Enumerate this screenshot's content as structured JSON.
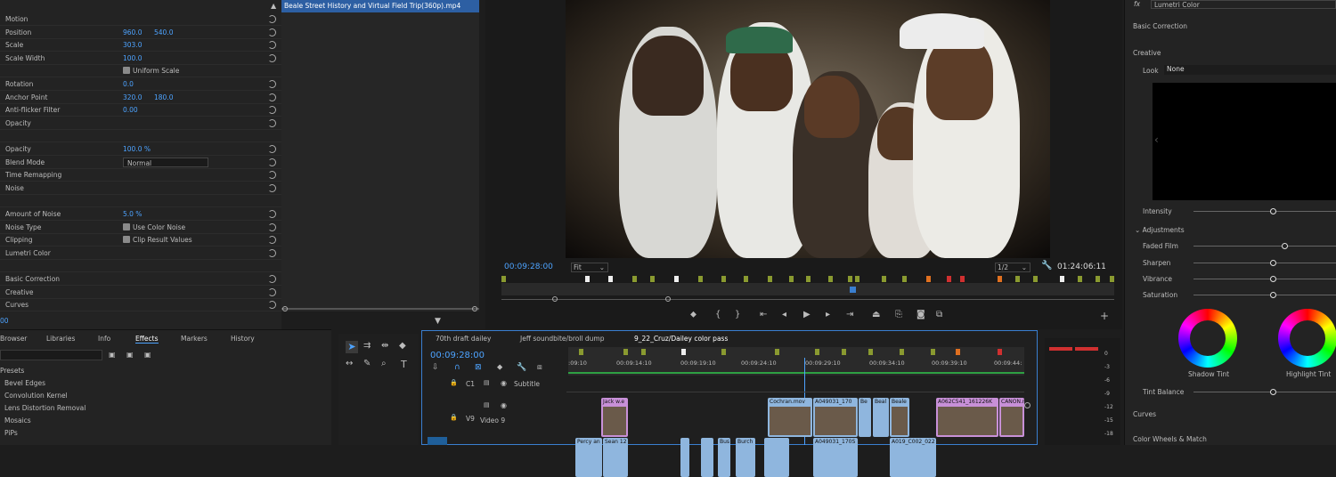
{
  "effect_controls": {
    "rows": [
      {
        "label": "Motion"
      },
      {
        "label": "Position",
        "v1": "960.0",
        "v2": "540.0"
      },
      {
        "label": "Scale",
        "v1": "303.0"
      },
      {
        "label": "Scale Width",
        "v1": "100.0"
      },
      {
        "label": "",
        "check": "Uniform Scale"
      },
      {
        "label": "Rotation",
        "v1": "0.0"
      },
      {
        "label": "Anchor Point",
        "v1": "320.0",
        "v2": "180.0"
      },
      {
        "label": "Anti-flicker Filter",
        "v1": "0.00"
      },
      {
        "label": "Opacity"
      },
      {
        "label": ""
      },
      {
        "label": "Opacity",
        "v1": "100.0 %"
      },
      {
        "label": "Blend Mode",
        "select": "Normal"
      },
      {
        "label": "Time Remapping"
      },
      {
        "label": "Noise"
      },
      {
        "label": ""
      },
      {
        "label": "Amount of Noise",
        "v1": "5.0 %"
      },
      {
        "label": "Noise Type",
        "check": "Use Color Noise"
      },
      {
        "label": "Clipping",
        "check": "Clip Result Values"
      },
      {
        "label": "Lumetri Color"
      },
      {
        "label": ""
      },
      {
        "label": "Basic Correction"
      },
      {
        "label": "Creative"
      },
      {
        "label": "Curves"
      }
    ],
    "timecode": "00"
  },
  "source_clip": "Beale Street History and Virtual Field Trip(360p).mp4",
  "program": {
    "timecode": "00:09:28:00",
    "fit": "Fit",
    "resolution": "1/2",
    "duration": "01:24:06:11"
  },
  "lumetri": {
    "effect": "Lumetri Color",
    "sections": [
      "Basic Correction",
      "Creative"
    ],
    "look_label": "Look",
    "look_value": "None",
    "intensity": "Intensity",
    "adjustments": "Adjustments",
    "sliders": [
      "Faded Film",
      "Sharpen",
      "Vibrance",
      "Saturation"
    ],
    "shadow": "Shadow Tint",
    "highlight": "Highlight Tint",
    "tint_balance": "Tint Balance",
    "curves": "Curves",
    "wheels": "Color Wheels & Match"
  },
  "effects_panel": {
    "tabs": [
      "Browser",
      "Libraries",
      "Info",
      "Effects",
      "Markers",
      "History"
    ],
    "items": [
      "Presets",
      "Bevel Edges",
      "Convolution Kernel",
      "Lens Distortion Removal",
      "Mosaics",
      "PiPs"
    ]
  },
  "timeline": {
    "tabs": [
      "70th draft dailey",
      "Jeff soundbite/broll dump",
      "9_22_Cruz/Dailey color pass"
    ],
    "timecode": "00:09:28:00",
    "ruler": [
      ":09:10",
      "00:09:14:10",
      "00:09:19:10",
      "00:09:24:10",
      "00:09:29:10",
      "00:09:34:10",
      "00:09:39:10",
      "00:09:44:"
    ],
    "tracks": [
      {
        "id": "C1",
        "name": "Subtitle"
      },
      {
        "id": "V9",
        "name": "Video 9"
      }
    ],
    "clips": [
      "Jack w.e",
      "Cochran.mov",
      "A049031_170",
      "Be",
      "Beal",
      "Beale",
      "A062C541_161226K",
      "CANON.m",
      "Percy an",
      "Sean 12",
      "Bus",
      "Burch",
      "A049031_170S",
      "A019_C002_022"
    ]
  },
  "meter_ticks": [
    "0",
    "-3",
    "-6",
    "-9",
    "-12",
    "-15",
    "-18"
  ],
  "colors": {
    "accent": "#4da3ff",
    "selected_tab": "#2d5fa3"
  }
}
